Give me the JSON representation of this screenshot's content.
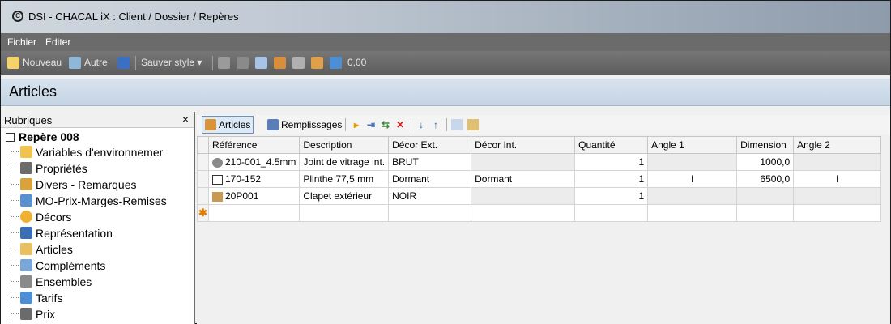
{
  "window": {
    "title": "DSI - CHACAL iX : Client / Dossier / Repères"
  },
  "menu": {
    "items": [
      "Fichier",
      "Editer"
    ]
  },
  "toolbar": {
    "nouveau": "Nouveau",
    "autre": "Autre",
    "sauver_style": "Sauver style ▾",
    "value": "0,00"
  },
  "section": {
    "title": "Articles"
  },
  "left_panel": {
    "header": "Rubriques",
    "close": "×",
    "root": "Repère 008",
    "items": [
      "Variables d'environnemer",
      "Propriétés",
      "Divers - Remarques",
      "MO-Prix-Marges-Remises",
      "Décors",
      "Représentation",
      "Articles",
      "Compléments",
      "Ensembles",
      "Tarifs",
      "Prix"
    ]
  },
  "grid_toolbar": {
    "articles": "Articles",
    "remplissages": "Remplissages"
  },
  "grid": {
    "columns": [
      "Référence",
      "Description",
      "Décor Ext.",
      "Décor Int.",
      "Quantité",
      "Angle 1",
      "Dimension",
      "Angle 2"
    ],
    "rows": [
      [
        "210-001_4.5mm",
        "Joint de vitrage int.",
        "BRUT",
        "",
        "1",
        "",
        "1000,0",
        ""
      ],
      [
        "170-152",
        "Plinthe 77,5 mm",
        "Dormant",
        "Dormant",
        "1",
        "I",
        "6500,0",
        "I"
      ],
      [
        "20P001",
        "Clapet extérieur",
        "NOIR",
        "",
        "1",
        "",
        "",
        ""
      ]
    ],
    "new_row_marker": "✱"
  }
}
